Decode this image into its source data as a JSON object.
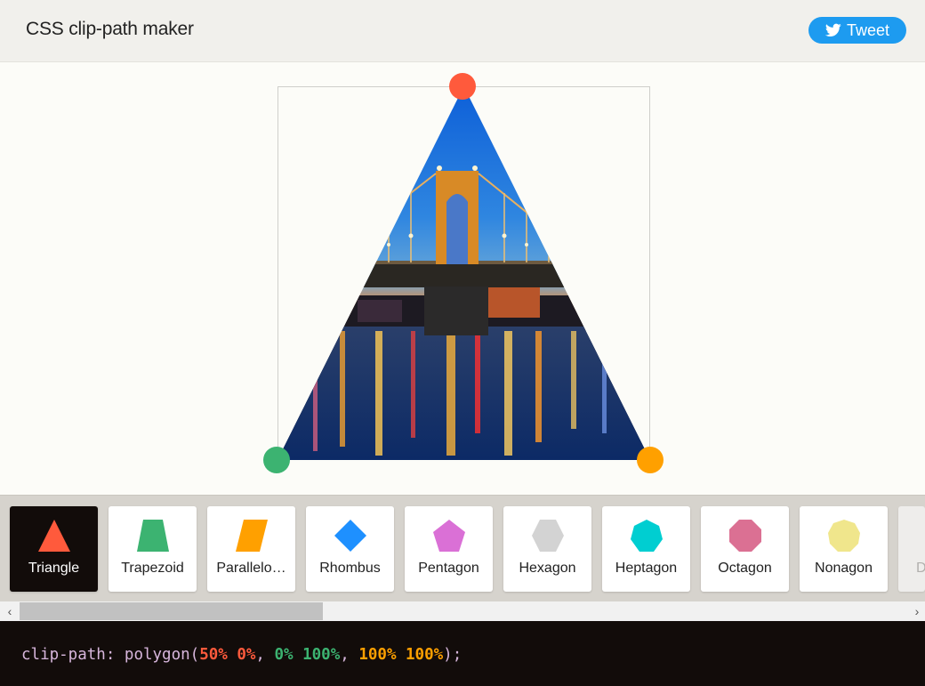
{
  "header": {
    "title": "CSS clip-path maker",
    "tweet_label": "Tweet",
    "tweet_icon": "twitter-bird-icon"
  },
  "editor": {
    "clip_path": "polygon(50% 0%, 0% 100%, 100% 100%)",
    "handles": [
      {
        "name": "top",
        "point": "50% 0%",
        "color": "#ff5a3c"
      },
      {
        "name": "bottom-left",
        "point": "0% 100%",
        "color": "#3cb371"
      },
      {
        "name": "bottom-right",
        "point": "100% 100%",
        "color": "#ffa000"
      }
    ]
  },
  "shapes": [
    {
      "label": "Triangle",
      "icon": "triangle-icon",
      "color": "#ff5a3c",
      "active": true
    },
    {
      "label": "Trapezoid",
      "icon": "trapezoid-icon",
      "color": "#3cb371",
      "active": false
    },
    {
      "label": "Parallelo…",
      "icon": "parallelogram-icon",
      "color": "#ffa000",
      "active": false
    },
    {
      "label": "Rhombus",
      "icon": "rhombus-icon",
      "color": "#1e90ff",
      "active": false
    },
    {
      "label": "Pentagon",
      "icon": "pentagon-icon",
      "color": "#da70d6",
      "active": false
    },
    {
      "label": "Hexagon",
      "icon": "hexagon-icon",
      "color": "#d3d3d3",
      "active": false
    },
    {
      "label": "Heptagon",
      "icon": "heptagon-icon",
      "color": "#00ced1",
      "active": false
    },
    {
      "label": "Octagon",
      "icon": "octagon-icon",
      "color": "#db7093",
      "active": false
    },
    {
      "label": "Nonagon",
      "icon": "nonagon-icon",
      "color": "#f0e68c",
      "active": false
    },
    {
      "label": "D",
      "icon": "decagon-icon",
      "color": "#dddddd",
      "active": false
    }
  ],
  "code": {
    "property": "clip-path:",
    "function": "polygon(",
    "p1": "50% 0%",
    "sep1": ", ",
    "p2": "0% 100%",
    "sep2": ", ",
    "p3": "100% 100%",
    "close": ");"
  },
  "scrollbar": {
    "left_arrow": "‹",
    "right_arrow": "›"
  }
}
